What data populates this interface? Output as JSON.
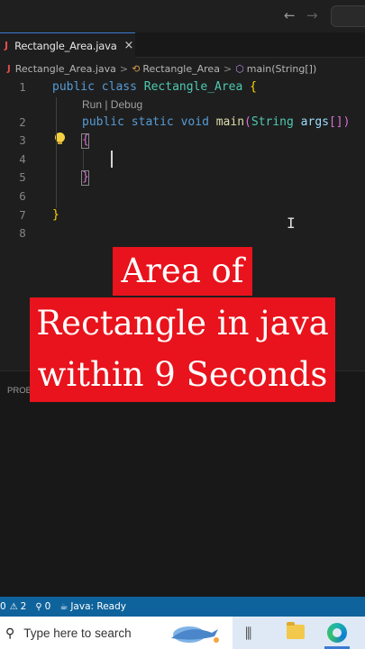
{
  "titlebar": {
    "back_icon": "arrow-left-icon",
    "forward_icon": "arrow-right-icon"
  },
  "tab": {
    "label": "Rectangle_Area.java",
    "close_glyph": "×",
    "icon_glyph": "J"
  },
  "breadcrumb": {
    "file": "Rectangle_Area.java",
    "class": "Rectangle_Area",
    "method": "main(String[])",
    "separator": ">"
  },
  "editor": {
    "line_numbers": [
      "1",
      "2",
      "3",
      "4",
      "5",
      "6",
      "7",
      "8"
    ],
    "codelens": "Run | Debug",
    "line1": {
      "kw1": "public",
      "kw2": "class",
      "name": "Rectangle_Area",
      "brace": "{"
    },
    "line2": {
      "kw1": "public",
      "kw2": "static",
      "kw3": "void",
      "fn": "main",
      "open": "(",
      "type": "String",
      "param": "args",
      "rest": "[])"
    },
    "line3": "{",
    "line5": "}",
    "line7": "}"
  },
  "overlay": {
    "line1": "Area of",
    "line2": "Rectangle in java",
    "line3": "within 9 Seconds",
    "bg_color": "#e8131c",
    "text_color": "#ffffff"
  },
  "panel": {
    "tab_label": "PROB"
  },
  "statusbar": {
    "errors": "0",
    "warnings": "2",
    "info": "0",
    "java_status": "Java: Ready",
    "color": "#0e639c"
  },
  "taskbar": {
    "search_placeholder": "Type here to search"
  }
}
